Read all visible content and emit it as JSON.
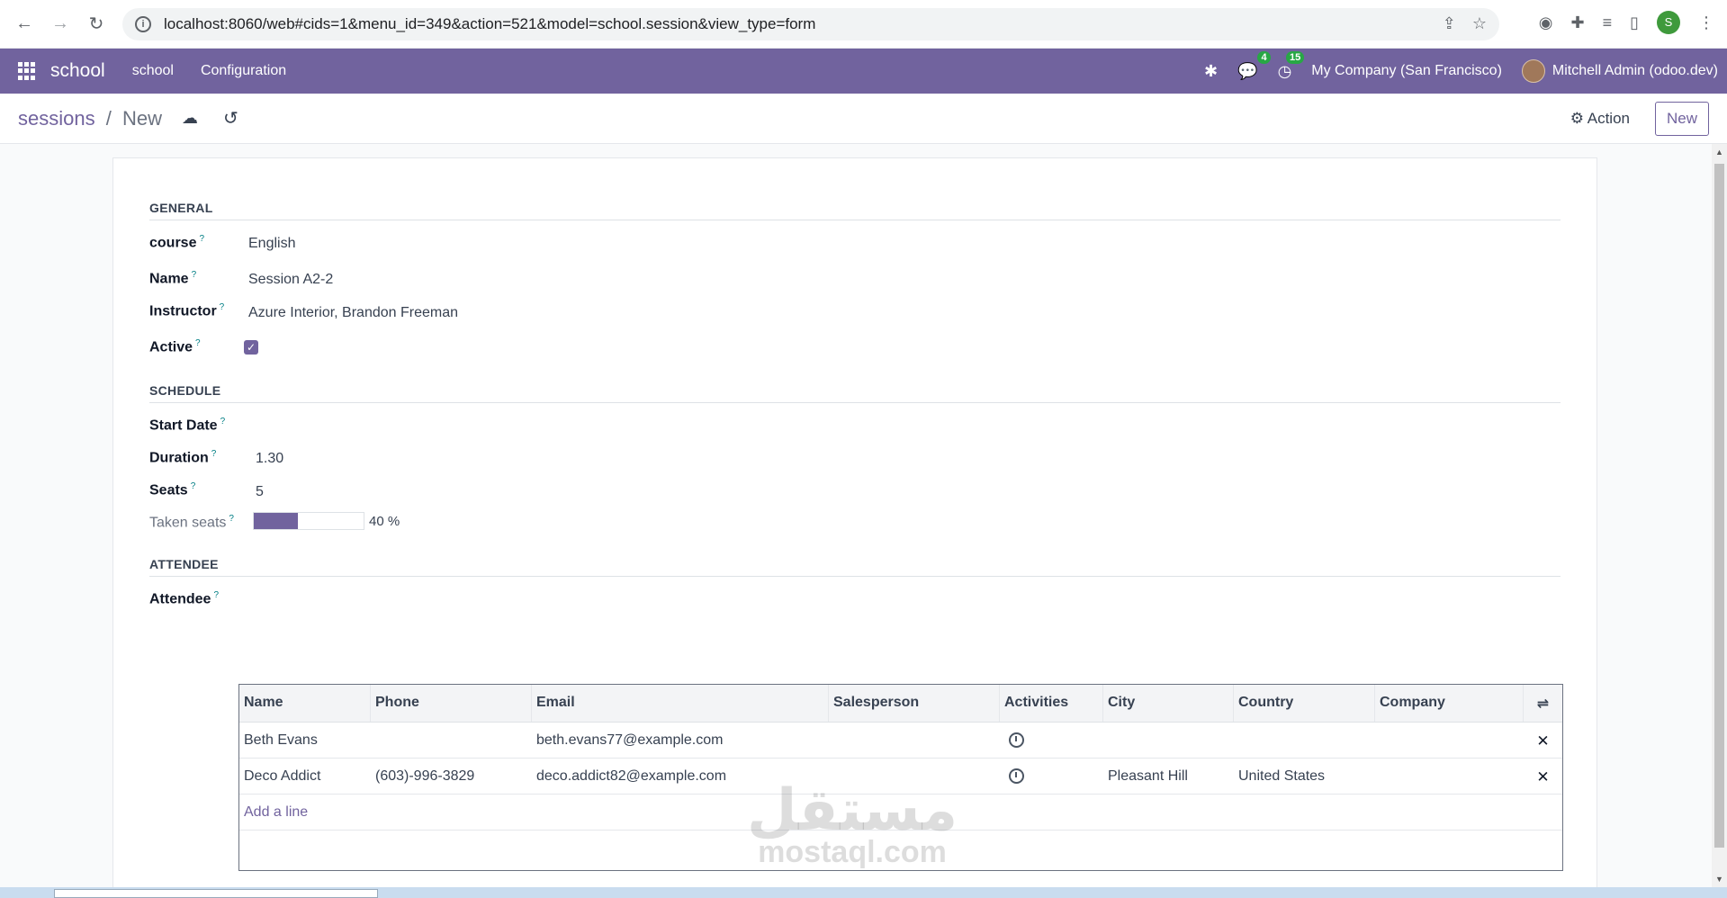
{
  "browser": {
    "url": "localhost:8060/web#cids=1&menu_id=349&action=521&model=school.session&view_type=form",
    "profile_initial": "S"
  },
  "navbar": {
    "app_name": "school",
    "menu_items": [
      "school",
      "Configuration"
    ],
    "messages_count": "4",
    "activities_count": "15",
    "company": "My Company (San Francisco)",
    "user": "Mitchell Admin (odoo.dev)",
    "accent_color": "#71639e"
  },
  "control_panel": {
    "breadcrumb_parent": "sessions",
    "breadcrumb_sep": "/",
    "breadcrumb_current": "New",
    "action_label": "Action",
    "new_label": "New"
  },
  "form": {
    "general_title": "GENERAL",
    "course_label": "course",
    "course_value": "English",
    "name_label": "Name",
    "name_value": "Session A2-2",
    "instructor_label": "Instructor",
    "instructor_value": "Azure Interior, Brandon Freeman",
    "active_label": "Active",
    "active_checked": true,
    "schedule_title": "SCHEDULE",
    "start_date_label": "Start Date",
    "start_date_value": "",
    "duration_label": "Duration",
    "duration_value": "1.30",
    "seats_label": "Seats",
    "seats_value": "5",
    "taken_seats_label": "Taken seats",
    "taken_seats_percent": 40,
    "taken_seats_text": "40 %",
    "attendee_title": "ATTENDEE",
    "attendee_label": "Attendee",
    "help_mark": "?"
  },
  "attendees": {
    "columns": [
      "Name",
      "Phone",
      "Email",
      "Salesperson",
      "Activities",
      "City",
      "Country",
      "Company"
    ],
    "rows": [
      {
        "name": "Beth Evans",
        "phone": "",
        "email": "beth.evans77@example.com",
        "salesperson": "",
        "city": "",
        "country": "",
        "company": ""
      },
      {
        "name": "Deco Addict",
        "phone": "(603)-996-3829",
        "email": "deco.addict82@example.com",
        "salesperson": "",
        "city": "Pleasant Hill",
        "country": "United States",
        "company": ""
      }
    ],
    "add_line": "Add a line"
  },
  "watermark": {
    "arabic": "مستقل",
    "latin": "mostaql.com"
  }
}
